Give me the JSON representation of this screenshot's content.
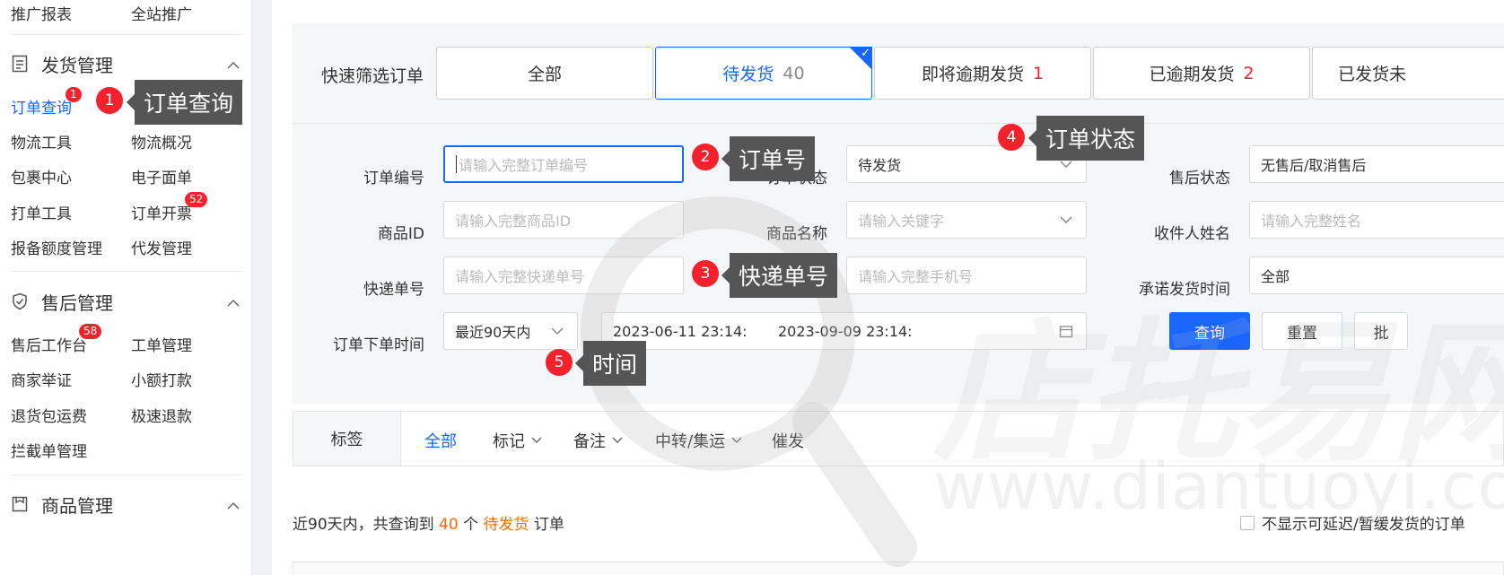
{
  "sidebar": {
    "top_row": [
      "推广报表",
      "全站推广"
    ],
    "sections": [
      {
        "title": "发货管理",
        "icon": "document-icon",
        "items": [
          "订单查询",
          "",
          "物流工具",
          "物流概况",
          "包裹中心",
          "电子面单",
          "打单工具",
          "订单开票",
          "报备额度管理",
          "代发管理"
        ],
        "badges": {
          "order_query": "1",
          "invoice": "52"
        }
      },
      {
        "title": "售后管理",
        "icon": "shield-check-icon",
        "items": [
          "售后工作台",
          "工单管理",
          "商家举证",
          "小额打款",
          "退货包运费",
          "极速退款",
          "拦截单管理"
        ],
        "badges": {
          "after_sales_desk": "58"
        }
      },
      {
        "title": "商品管理",
        "icon": "box-icon",
        "items": []
      }
    ]
  },
  "quick_filter": {
    "label": "快速筛选订单",
    "buttons": [
      {
        "label": "全部",
        "count": ""
      },
      {
        "label": "待发货",
        "count": "40"
      },
      {
        "label": "即将逾期发货",
        "count": "1"
      },
      {
        "label": "已逾期发货",
        "count": "2"
      },
      {
        "label": "已发货未",
        "count": ""
      }
    ]
  },
  "form": {
    "order_no": {
      "label": "订单编号",
      "placeholder": "请输入完整订单编号"
    },
    "order_status": {
      "label": "订单状态",
      "value": "待发货"
    },
    "aftersale_status": {
      "label": "售后状态",
      "value": "无售后/取消售后"
    },
    "product_id": {
      "label": "商品ID",
      "placeholder": "请输入完整商品ID"
    },
    "product_name": {
      "label": "商品名称",
      "placeholder": "请输入关键字"
    },
    "receiver_name": {
      "label": "收件人姓名",
      "placeholder": "请输入完整姓名"
    },
    "tracking_no": {
      "label": "快递单号",
      "placeholder": "请输入完整快递单号"
    },
    "phone": {
      "placeholder": "请输入完整手机号"
    },
    "promise_time": {
      "label": "承诺发货时间",
      "value": "全部"
    },
    "order_time": {
      "label": "订单下单时间",
      "range": "最近90天内",
      "start": "2023-06-11 23:14:",
      "end": "2023-09-09 23:14:"
    },
    "buttons": {
      "query": "查询",
      "reset": "重置",
      "batch": "批"
    }
  },
  "tags": {
    "title": "标签",
    "items": [
      "全部",
      "标记",
      "备注",
      "中转/集运",
      "催发"
    ]
  },
  "summary": {
    "prefix": "近90天内，共查询到",
    "count": "40",
    "middle": "个",
    "status": "待发货",
    "suffix": "订单",
    "checkbox_label": "不显示可延迟/暂缓发货的订单"
  },
  "annotations": [
    {
      "num": "1",
      "text": "订单查询"
    },
    {
      "num": "2",
      "text": "订单号"
    },
    {
      "num": "3",
      "text": "快递单号"
    },
    {
      "num": "4",
      "text": "订单状态"
    },
    {
      "num": "5",
      "text": "时间"
    }
  ],
  "watermark": {
    "text": "店托易网",
    "url_text": "www.diantuoyi.com"
  },
  "colors": {
    "accent": "#1966ff",
    "badge": "#f5222d",
    "highlight": "#ff6a00",
    "tooltip": "#555555"
  }
}
